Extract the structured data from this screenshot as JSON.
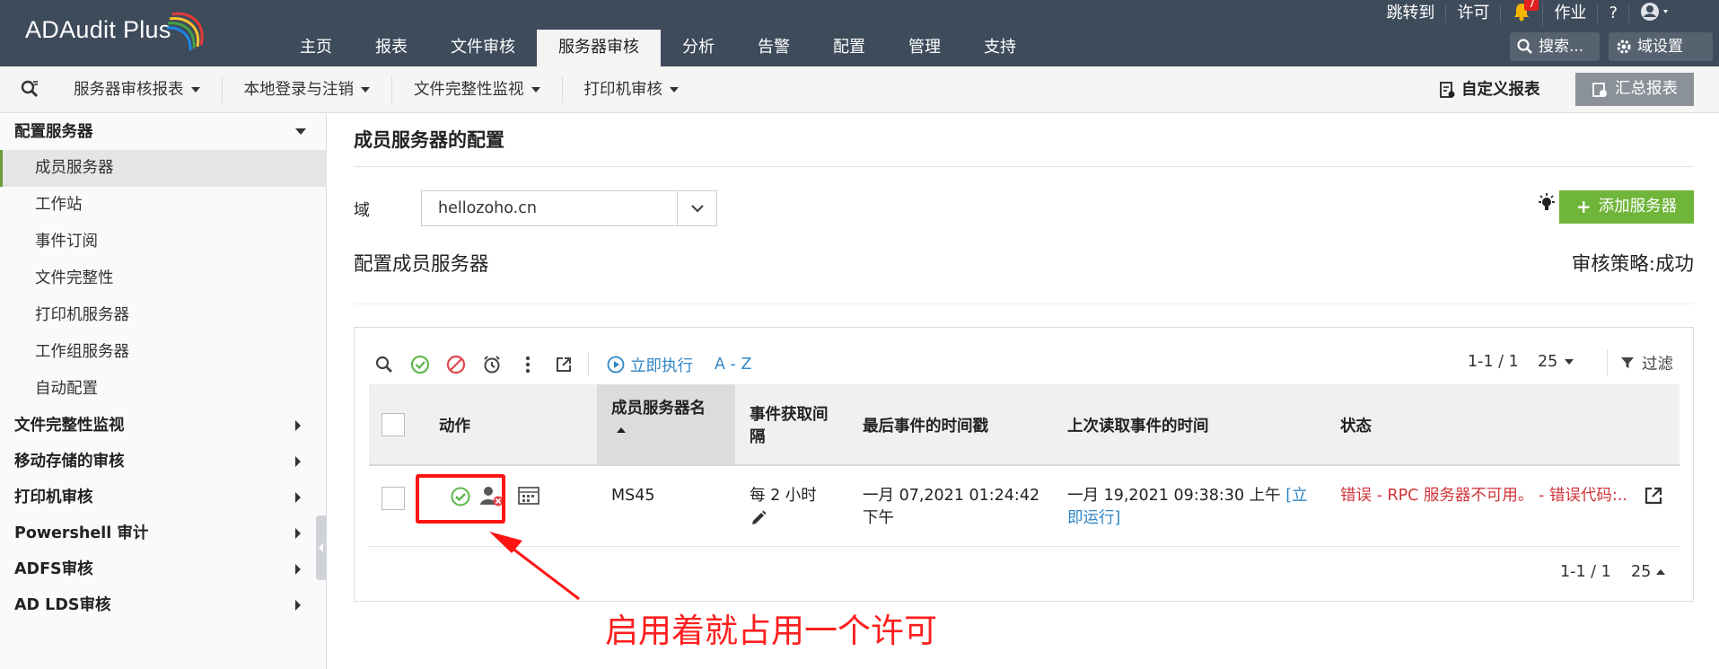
{
  "app": {
    "name": "ADAudit Plus"
  },
  "top_nav": {
    "tabs": [
      "主页",
      "报表",
      "文件审核",
      "服务器审核",
      "分析",
      "告警",
      "配置",
      "管理",
      "支持"
    ],
    "active_tab": "服务器审核"
  },
  "top_links": {
    "jump": "跳转到",
    "license": "许可",
    "notification_count": "7",
    "jobs": "作业",
    "help": "?"
  },
  "top_buttons": {
    "search": "搜索...",
    "domain_settings": "域设置"
  },
  "sub_nav": {
    "items": [
      "服务器审核报表",
      "本地登录与注销",
      "文件完整性监视",
      "打印机审核"
    ],
    "custom_report": "自定义报表",
    "summary_report": "汇总报表"
  },
  "sidebar": {
    "sections": [
      {
        "label": "配置服务器",
        "expanded": true,
        "items": [
          "成员服务器",
          "工作站",
          "事件订阅",
          "文件完整性",
          "打印机服务器",
          "工作组服务器",
          "自动配置"
        ],
        "active_item": "成员服务器"
      },
      {
        "label": "文件完整性监视",
        "expanded": false
      },
      {
        "label": "移动存储的审核",
        "expanded": false
      },
      {
        "label": "打印机审核",
        "expanded": false
      },
      {
        "label": "Powershell 审计",
        "expanded": false
      },
      {
        "label": "ADFS审核",
        "expanded": false
      },
      {
        "label": "AD LDS审核",
        "expanded": false
      }
    ]
  },
  "main": {
    "page_title": "成员服务器的配置",
    "domain_label": "域",
    "domain_value": "hellozoho.cn",
    "add_server": "添加服务器",
    "config_title": "配置成员服务器",
    "audit_policy": "审核策略:成功"
  },
  "grid": {
    "run_now": "立即执行",
    "az": "A - Z",
    "pager_top": "1-1 / 1",
    "page_size": "25",
    "filter": "过滤",
    "columns": {
      "action": "动作",
      "server_name": "成员服务器名",
      "interval": "事件获取间隔",
      "last_event": "最后事件的时间戳",
      "last_read": "上次读取事件的时间",
      "status": "状态"
    },
    "rows": [
      {
        "server_name": "MS45",
        "interval": "每 2 小时",
        "last_event": "一月 07,2021 01:24:42 下午",
        "last_read_time": "一月 19,2021 09:38:30 上午",
        "run_now_link": "[立即运行]",
        "status": "错误 - RPC 服务器不可用。 - 错误代码:.."
      }
    ],
    "pager_bottom": "1-1 / 1"
  },
  "annotation": {
    "text": "启用着就占用一个许可"
  },
  "colors": {
    "header_bg": "#3e4b5b",
    "accent_green": "#6fb53a",
    "link_blue": "#2f86c6",
    "error_red": "#d0343a",
    "annotation_red": "#ff1414"
  }
}
